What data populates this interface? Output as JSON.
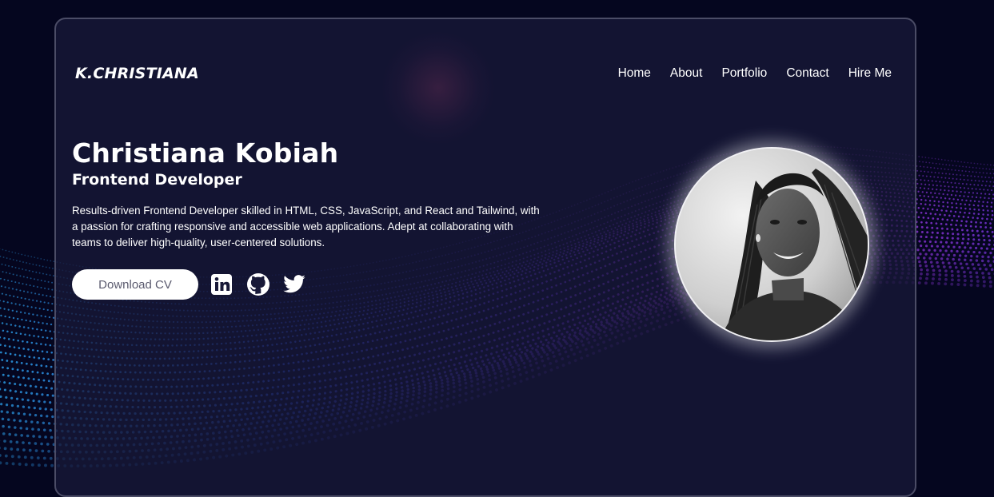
{
  "brand": {
    "logo_text": "K.CHRISTIANA"
  },
  "nav": {
    "items": [
      {
        "label": "Home"
      },
      {
        "label": "About"
      },
      {
        "label": "Portfolio"
      },
      {
        "label": "Contact"
      },
      {
        "label": "Hire Me"
      }
    ]
  },
  "hero": {
    "name": "Christiana Kobiah",
    "role": "Frontend Developer",
    "description": "Results-driven Frontend Developer skilled in HTML, CSS, JavaScript, and React and Tailwind, with a passion for crafting responsive and accessible web applications. Adept at collaborating with teams to deliver high-quality, user-centered solutions.",
    "cta_label": "Download CV",
    "social_icons": [
      "linkedin-icon",
      "github-icon",
      "twitter-icon"
    ],
    "photo": {
      "style": "grayscale portrait",
      "subject": "woman with long braided hair, smiling"
    }
  },
  "colors": {
    "page_bg": "#05061f",
    "card_bg": "#181938",
    "card_border": "#4b4c66",
    "wave_purple": "#b02ccf",
    "wave_blue": "#2e4fe0",
    "wave_cyan": "#2aa6e8",
    "button_bg": "#ffffff",
    "button_text": "#5a5a6e",
    "text": "#ffffff"
  }
}
